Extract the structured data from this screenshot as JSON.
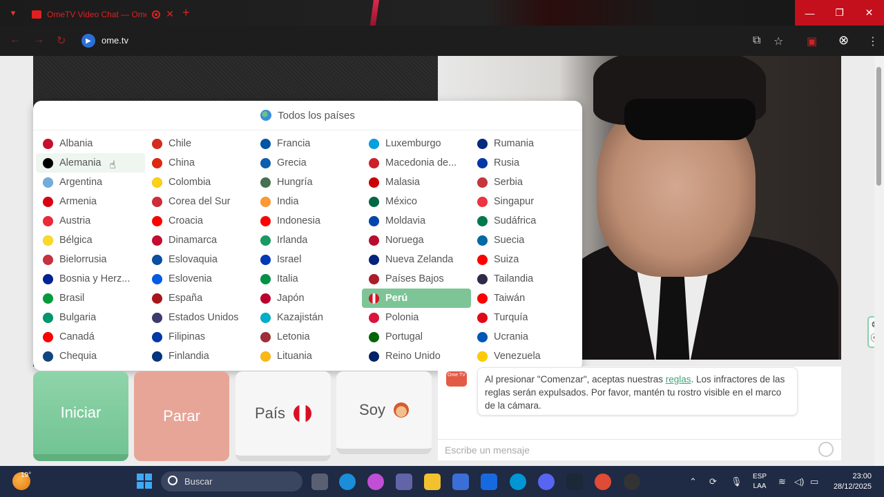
{
  "browser": {
    "tab_title": "OmeTV Video Chat — Omegle",
    "tab_close": "✕",
    "new_tab": "+",
    "url": "ome.tv",
    "window_controls": [
      "—",
      "❐",
      "✕"
    ]
  },
  "dropdown": {
    "header": "Todos los países",
    "columns": [
      [
        "Albania",
        "Alemania",
        "Argentina",
        "Armenia",
        "Austria",
        "Bélgica",
        "Bielorrusia",
        "Bosnia y Herz...",
        "Brasil",
        "Bulgaria",
        "Canadá",
        "Chequia"
      ],
      [
        "Chile",
        "China",
        "Colombia",
        "Corea del Sur",
        "Croacia",
        "Dinamarca",
        "Eslovaquia",
        "Eslovenia",
        "España",
        "Estados Unidos",
        "Filipinas",
        "Finlandia"
      ],
      [
        "Francia",
        "Grecia",
        "Hungría",
        "India",
        "Indonesia",
        "Irlanda",
        "Israel",
        "Italia",
        "Japón",
        "Kazajistán",
        "Letonia",
        "Lituania"
      ],
      [
        "Luxemburgo",
        "Macedonia de...",
        "Malasia",
        "México",
        "Moldavia",
        "Noruega",
        "Nueva Zelanda",
        "Países Bajos",
        "Perú",
        "Polonia",
        "Portugal",
        "Reino Unido"
      ],
      [
        "Rumania",
        "Rusia",
        "Serbia",
        "Singapur",
        "Sudáfrica",
        "Suecia",
        "Suiza",
        "Tailandia",
        "Taiwán",
        "Turquía",
        "Ucrania",
        "Venezuela"
      ]
    ],
    "hovered": "Alemania",
    "selected": "Perú"
  },
  "controls": {
    "start": "Iniciar",
    "stop": "Parar",
    "country": "País",
    "gender": "Soy"
  },
  "chat": {
    "logo": "Ome TV",
    "message_before": "Al presionar \"Comenzar\", aceptas nuestras ",
    "message_link": "reglas",
    "message_after": ". Los infractores de las reglas serán expulsados. Por favor, mantén tu rostro visible en el marco de la cámara.",
    "input_placeholder": "Escribe un mensaje"
  },
  "taskbar": {
    "temperature": "19°",
    "search_placeholder": "Buscar",
    "language_line1": "ESP",
    "language_line2": "LAA",
    "time": "23:00",
    "date": "28/12/2025"
  }
}
